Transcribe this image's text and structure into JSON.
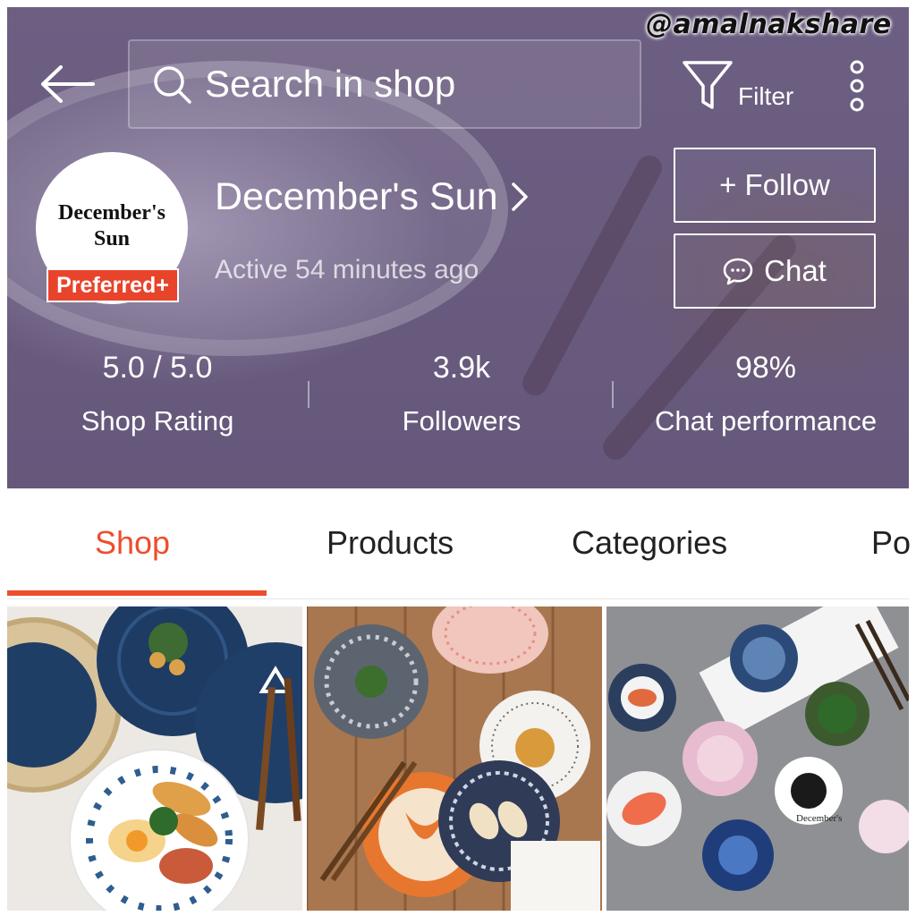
{
  "watermark": "@amalnakshare",
  "header": {
    "search_placeholder": "Search in shop",
    "filter_label": "Filter"
  },
  "shop": {
    "logo_line1": "December's",
    "logo_line2": "Sun",
    "badge": "Preferred+",
    "name": "December's Sun",
    "active_status": "Active 54 minutes ago",
    "follow_label": "+ Follow",
    "chat_label": "Chat"
  },
  "stats": [
    {
      "value": "5.0 / 5.0",
      "label": "Shop Rating"
    },
    {
      "value": "3.9k",
      "label": "Followers"
    },
    {
      "value": "98%",
      "label": "Chat performance"
    }
  ],
  "tabs": [
    {
      "label": "Shop",
      "active": true
    },
    {
      "label": "Products",
      "active": false
    },
    {
      "label": "Categories",
      "active": false
    },
    {
      "label": "Po",
      "active": false
    }
  ],
  "products": [
    {
      "image": "blue-patterned-plates-with-breakfast"
    },
    {
      "image": "assorted-japanese-plates-on-wood-table"
    },
    {
      "image": "flower-shaped-sauce-dishes"
    }
  ],
  "product_watermark": "December's",
  "colors": {
    "accent": "#ee4d2d",
    "badge": "#e8442c",
    "banner": "#6a5c7f"
  }
}
